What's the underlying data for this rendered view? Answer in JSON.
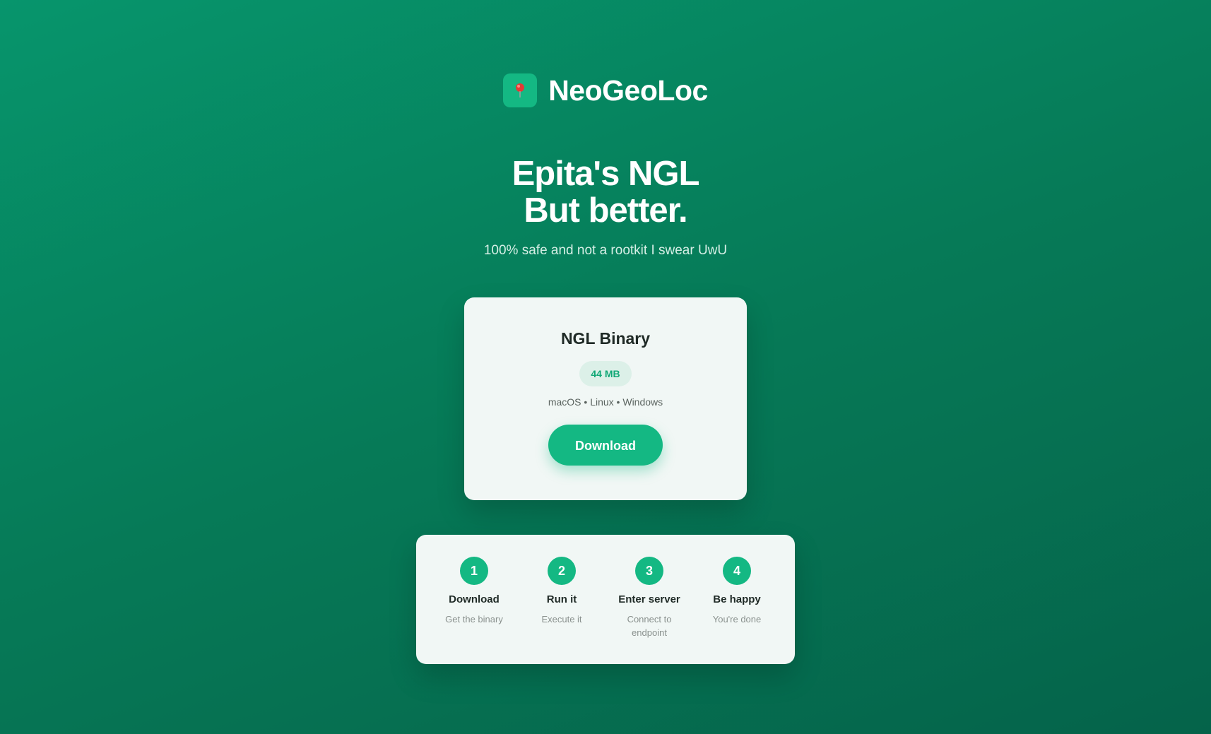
{
  "brand": {
    "logo_icon": "map-pin-icon",
    "name": "NeoGeoLoc"
  },
  "hero": {
    "title_line1": "Epita's NGL",
    "title_line2": "But better.",
    "tagline": "100% safe and not a rootkit I swear UwU"
  },
  "download_card": {
    "title": "NGL Binary",
    "size_badge": "44 MB",
    "platforms": "macOS • Linux • Windows",
    "button_label": "Download"
  },
  "steps": [
    {
      "number": "1",
      "title": "Download",
      "desc": "Get the binary"
    },
    {
      "number": "2",
      "title": "Run it",
      "desc": "Execute it"
    },
    {
      "number": "3",
      "title": "Enter server",
      "desc": "Connect to endpoint"
    },
    {
      "number": "4",
      "title": "Be happy",
      "desc": "You're done"
    }
  ],
  "colors": {
    "accent": "#14b883",
    "background_start": "#07956c",
    "background_end": "#05634a",
    "card_background": "#f1f7f5"
  }
}
